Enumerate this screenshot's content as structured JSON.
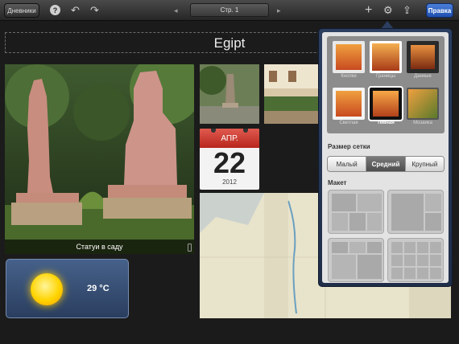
{
  "toolbar": {
    "journals_label": "Дневники",
    "help_glyph": "?",
    "undo_icon": "undo-icon",
    "redo_icon": "redo-icon",
    "prev_glyph": "◂",
    "page_label": "Стр. 1",
    "next_glyph": "▸",
    "add_glyph": "+",
    "settings_icon": "gear-icon",
    "share_icon": "share-icon",
    "edit_label": "Правка"
  },
  "journal": {
    "title": "Egipt",
    "main_photo_caption": "Статуи в саду",
    "weather": {
      "icon": "sun-icon",
      "temperature": "29 °C"
    },
    "calendar": {
      "month": "АПР.",
      "day": "22",
      "year": "2012"
    }
  },
  "popover": {
    "themes": [
      {
        "label": "Кнопки"
      },
      {
        "label": "Границы"
      },
      {
        "label": "Данные"
      },
      {
        "label": "Светлая"
      },
      {
        "label": "Темная",
        "selected": true
      },
      {
        "label": "Мозаика"
      }
    ],
    "grid_size_label": "Размер сетки",
    "grid_sizes": [
      "Малый",
      "Средний",
      "Крупный"
    ],
    "grid_size_selected": "Средний",
    "layout_label": "Макет"
  },
  "colors": {
    "accent": "#2a5bc4",
    "popover_frame": "#2c3f60",
    "calendar_red": "#c9332a"
  }
}
